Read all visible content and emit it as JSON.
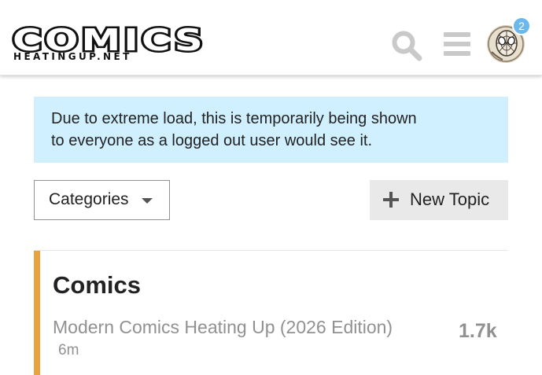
{
  "site": {
    "logo_main": "COMICS",
    "logo_sub": "HEATINGUP.NET"
  },
  "header": {
    "search_icon": "search-icon",
    "menu_icon": "hamburger-menu-icon",
    "avatar_icon": "user-avatar",
    "notification_count": "2",
    "notification_color": "#6bb8ed"
  },
  "notice": {
    "line1": "Due to extreme load, this is temporarily being shown",
    "line2": "to everyone as a logged out user would see it.",
    "background": "#d1f0ff"
  },
  "controls": {
    "categories_label": "Categories",
    "new_topic_label": "New Topic"
  },
  "category": {
    "name": "Comics",
    "color": "#e8a33d",
    "latest_topic": {
      "title": "Modern Comics Heating Up (2026 Edition)",
      "age": "6m",
      "count": "1.7k"
    }
  }
}
